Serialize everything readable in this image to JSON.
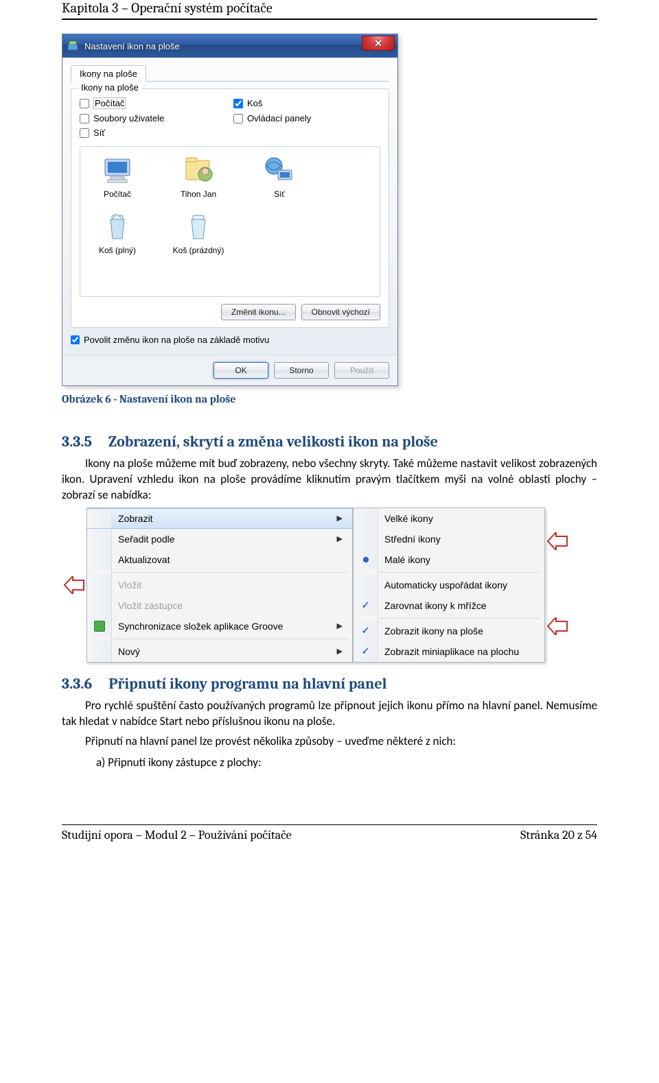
{
  "chapter_header": "Kapitola 3 – Operační systém počítače",
  "dialog": {
    "title": "Nastavení ikon na ploše",
    "tab": "Ikony na ploše",
    "groupbox_label": "Ikony na ploše",
    "checks": {
      "computer": "Počítač",
      "recycle": "Koš",
      "userfiles": "Soubory uživatele",
      "controlpanels": "Ovládací panely",
      "network": "Síť"
    },
    "icons": {
      "computer": "Počítač",
      "user": "Tihon Jan",
      "network": "Síť",
      "recycle_full": "Koš (plný)",
      "recycle_empty": "Koš (prázdný)"
    },
    "btn_change": "Změnit ikonu...",
    "btn_restore": "Obnovit výchozí",
    "allow_theme": "Povolit změnu ikon na ploše na základě motivu",
    "btn_ok": "OK",
    "btn_cancel": "Storno",
    "btn_apply": "Použít"
  },
  "caption": "Obrázek 6 - Nastavení ikon na ploše",
  "section_335": {
    "num": "3.3.5",
    "title": "Zobrazení, skrytí a změna velikosti ikon na ploše",
    "p1": "Ikony na ploše můžeme mít buď zobrazeny, nebo všechny skryty. Také můžeme nastavit velikost zobrazených ikon. Upravení vzhledu ikon na ploše provádíme kliknutím pravým tlačítkem myši na volné oblasti plochy – zobrazí se nabídka:"
  },
  "context_left": {
    "view": "Zobrazit",
    "sort": "Seřadit podle",
    "refresh": "Aktualizovat",
    "paste": "Vložit",
    "paste_shortcut": "Vložit zástupce",
    "groove": "Synchronizace složek aplikace Groove",
    "new": "Nový"
  },
  "context_right": {
    "large": "Velké ikony",
    "medium": "Střední ikony",
    "small": "Malé ikony",
    "auto": "Automaticky uspořádat ikony",
    "align": "Zarovnat ikony k mřížce",
    "show_icons": "Zobrazit ikony na ploše",
    "show_gadgets": "Zobrazit miniaplikace na plochu"
  },
  "section_336": {
    "num": "3.3.6",
    "title": "Připnutí ikony programu na hlavní panel",
    "p1": "Pro rychlé spuštění často používaných programů lze připnout jejich ikonu přímo na hlavní panel. Nemusíme tak hledat v nabídce Start nebo příslušnou ikonu na ploše.",
    "p2": "Připnutí na hlavní panel lze provést několika způsoby – uveďme některé z nich:",
    "a": "a)   Připnutí ikony zástupce z plochy:"
  },
  "footer": {
    "left": "Studijní opora – Modul 2 – Používání počítače",
    "right": "Stránka 20 z 54"
  }
}
